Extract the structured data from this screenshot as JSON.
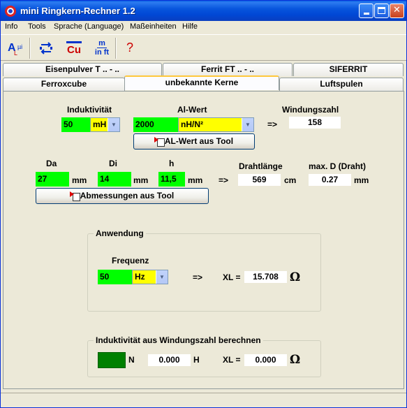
{
  "window": {
    "title": "mini Ringkern-Rechner 1.2"
  },
  "titlebar_buttons": {
    "minimize": "",
    "maximize": "",
    "close": "✕"
  },
  "menu": [
    "Info",
    "Tools",
    "Sprache (Language)",
    "Maßeinheiten",
    "Hilfe"
  ],
  "toolbar": {
    "al_label": "A",
    "al_sub": "L",
    "al_mu": "µi",
    "cu_label": "Cu",
    "units_top": "m",
    "units_bottom": "in ft",
    "help_label": "?"
  },
  "tabs": {
    "row1": [
      "Eisenpulver T .. - ..",
      "Ferrit FT .. - ..",
      "SIFERRIT"
    ],
    "row2": [
      "Ferroxcube",
      "unbekannte Kerne",
      "Luftspulen"
    ]
  },
  "induct": {
    "label": "Induktivität",
    "value": "50",
    "unit": "mH"
  },
  "alwert": {
    "label": "Al-Wert",
    "value": "2000",
    "unit": "nH/N²",
    "button": "AL-Wert aus Tool"
  },
  "windungen": {
    "arrow": "=>",
    "label": "Windungszahl",
    "value": "158"
  },
  "dims": {
    "da_label": "Da",
    "da_value": "27",
    "di_label": "Di",
    "di_value": "14",
    "h_label": "h",
    "h_value": "11,5",
    "unit": "mm",
    "arrow": "=>",
    "button": "Abmessungen aus Tool"
  },
  "draht": {
    "length_label": "Drahtlänge",
    "length_value": "569",
    "length_unit": "cm",
    "maxd_label": "max. D (Draht)",
    "maxd_value": "0.27",
    "maxd_unit": "mm"
  },
  "anwendung": {
    "title": "Anwendung",
    "freq_label": "Frequenz",
    "freq_value": "50",
    "freq_unit": "Hz",
    "arrow": "=>",
    "xl_label": "XL =",
    "xl_value": "15.708",
    "omega": "Ω"
  },
  "ind_calc": {
    "title": "Induktivität aus Windungszahl berechnen",
    "n_label": "N",
    "h_value": "0.000",
    "h_label": "H",
    "xl_label": "XL =",
    "xl_value": "0.000",
    "omega": "Ω"
  },
  "colors": {
    "input_green": "#00ff00",
    "unit_yellow": "#ffff00",
    "titlebar_blue": "#0855dd",
    "ind_n_green": "#008000"
  }
}
